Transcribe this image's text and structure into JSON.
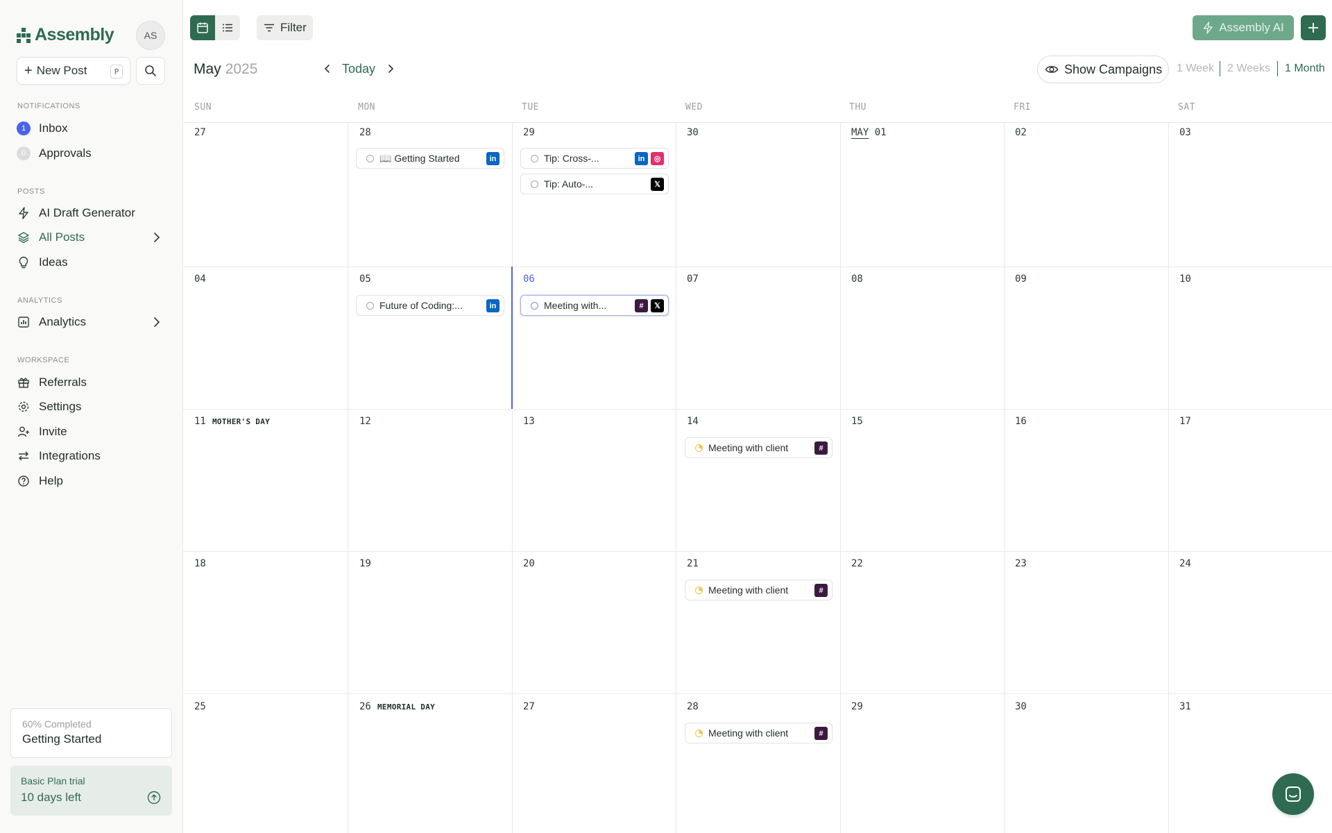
{
  "brand": {
    "name": "Assembly",
    "color": "#2f6b52"
  },
  "user": {
    "initials": "AS"
  },
  "sidebar": {
    "new_post": {
      "label": "New Post",
      "shortcut": "P"
    },
    "sections": {
      "notifications": "NOTIFICATIONS",
      "posts": "POSTS",
      "analytics": "ANALYTICS",
      "workspace": "WORKSPACE"
    },
    "notifications": [
      {
        "label": "Inbox",
        "count": "1"
      },
      {
        "label": "Approvals",
        "count": "0"
      }
    ],
    "posts": [
      {
        "label": "AI Draft Generator",
        "icon": "bolt-icon"
      },
      {
        "label": "All Posts",
        "icon": "layers-icon",
        "active": true
      },
      {
        "label": "Ideas",
        "icon": "lightbulb-icon"
      }
    ],
    "analytics": [
      {
        "label": "Analytics",
        "icon": "chart-icon"
      }
    ],
    "workspace": [
      {
        "label": "Referrals",
        "icon": "gift-icon"
      },
      {
        "label": "Settings",
        "icon": "gear-icon"
      },
      {
        "label": "Invite",
        "icon": "user-plus-icon"
      },
      {
        "label": "Integrations",
        "icon": "arrows-icon"
      },
      {
        "label": "Help",
        "icon": "help-icon"
      }
    ],
    "progress": {
      "status": "60% Completed",
      "value": 0.6,
      "title": "Getting Started"
    },
    "trial": {
      "plan": "Basic Plan trial",
      "remaining": "10 days left"
    }
  },
  "toolbar": {
    "filter_label": "Filter",
    "ai_label": "Assembly AI",
    "month": "May",
    "year": "2025",
    "today_label": "Today",
    "show_campaigns": "Show Campaigns",
    "ranges": [
      "1 Week",
      "2 Weeks",
      "1 Month"
    ],
    "active_range": "1 Month"
  },
  "calendar": {
    "weekdays": [
      "SUN",
      "MON",
      "TUE",
      "WED",
      "THU",
      "FRI",
      "SAT"
    ],
    "weeks": [
      [
        "27",
        "28",
        "29",
        "30",
        "01",
        "02",
        "03"
      ],
      [
        "04",
        "05",
        "06",
        "07",
        "08",
        "09",
        "10"
      ],
      [
        "11",
        "12",
        "13",
        "14",
        "15",
        "16",
        "17"
      ],
      [
        "18",
        "19",
        "20",
        "21",
        "22",
        "23",
        "24"
      ],
      [
        "25",
        "26",
        "27",
        "28",
        "29",
        "30",
        "31"
      ]
    ],
    "month_marker": "MAY",
    "today": "06",
    "holidays": {
      "mothers_day": "MOTHER'S DAY",
      "memorial_day": "MEMORIAL DAY"
    },
    "posts": {
      "getting_started": {
        "title": "📖 Getting Started",
        "status": "draft",
        "channels": [
          "linkedin"
        ]
      },
      "tip_cross": {
        "title": "Tip: Cross-...",
        "status": "draft",
        "channels": [
          "linkedin",
          "instagram"
        ]
      },
      "tip_auto": {
        "title": "Tip: Auto-...",
        "status": "draft",
        "channels": [
          "x"
        ]
      },
      "future_coding": {
        "title": "Future of Coding:...",
        "status": "draft",
        "channels": [
          "linkedin"
        ]
      },
      "meeting_06": {
        "title": "Meeting with...",
        "status": "approved",
        "channels": [
          "slack",
          "x"
        ]
      },
      "meeting_14": {
        "title": "Meeting with client",
        "status": "scheduled",
        "channels": [
          "slack"
        ]
      },
      "meeting_21": {
        "title": "Meeting with client",
        "status": "scheduled",
        "channels": [
          "slack"
        ]
      },
      "meeting_28": {
        "title": "Meeting with client",
        "status": "scheduled",
        "channels": [
          "slack"
        ]
      }
    }
  }
}
